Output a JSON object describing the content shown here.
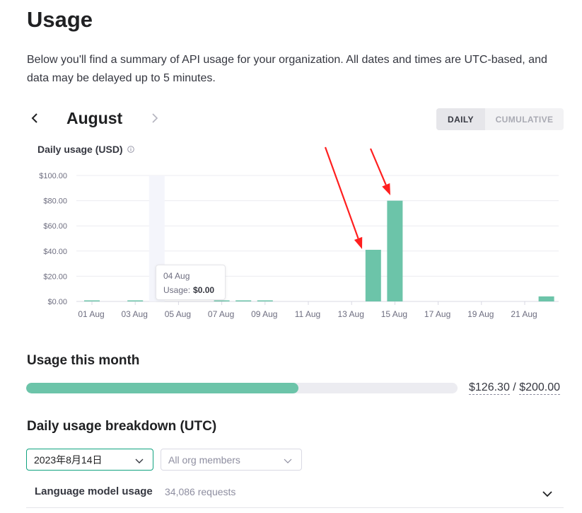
{
  "page": {
    "title": "Usage",
    "description": "Below you'll find a summary of API usage for your organization. All dates and times are UTC-based, and data may be delayed up to 5 minutes."
  },
  "month_nav": {
    "prev_icon": "chevron-left-icon",
    "month": "August",
    "next_icon": "chevron-right-icon"
  },
  "view_toggle": {
    "daily": "DAILY",
    "cumulative": "CUMULATIVE",
    "active": "daily"
  },
  "chart_title": "Daily usage (USD)",
  "tooltip": {
    "date": "04 Aug",
    "label": "Usage:",
    "value": "$0.00"
  },
  "chart_data": {
    "type": "bar",
    "title": "Daily usage (USD)",
    "xlabel": "",
    "ylabel": "",
    "ylim": [
      0,
      100
    ],
    "grid": true,
    "y_ticks": [
      "$0.00",
      "$20.00",
      "$40.00",
      "$60.00",
      "$80.00",
      "$100.00"
    ],
    "y_tick_values": [
      0,
      20,
      40,
      60,
      80,
      100
    ],
    "x_ticks": [
      "01 Aug",
      "03 Aug",
      "05 Aug",
      "07 Aug",
      "09 Aug",
      "11 Aug",
      "13 Aug",
      "15 Aug",
      "17 Aug",
      "19 Aug",
      "21 Aug"
    ],
    "categories": [
      "01 Aug",
      "02 Aug",
      "03 Aug",
      "04 Aug",
      "05 Aug",
      "06 Aug",
      "07 Aug",
      "08 Aug",
      "09 Aug",
      "10 Aug",
      "11 Aug",
      "12 Aug",
      "13 Aug",
      "14 Aug",
      "15 Aug",
      "16 Aug",
      "17 Aug",
      "18 Aug",
      "19 Aug",
      "20 Aug",
      "21 Aug",
      "22 Aug"
    ],
    "values": [
      0.3,
      0,
      0.8,
      0,
      0,
      0,
      0.2,
      0.2,
      0.2,
      0,
      0,
      0,
      0,
      41,
      80,
      0,
      0,
      0,
      0,
      0,
      0,
      4
    ],
    "hover_index": 3,
    "bar_color": "#6cc4a9"
  },
  "usage_month": {
    "title": "Usage this month",
    "used": "$126.30",
    "separator": "/",
    "limit": "$200.00",
    "fraction": 0.6315
  },
  "breakdown": {
    "title": "Daily usage breakdown (UTC)",
    "date_select": "2023年8月14日",
    "members_select": "All org members",
    "row_label": "Language model usage",
    "row_count": "34,086 requests"
  },
  "colors": {
    "accent": "#6cc4a9",
    "focus_border": "#10a37f",
    "annotation_arrow": "#ff1f1f"
  }
}
